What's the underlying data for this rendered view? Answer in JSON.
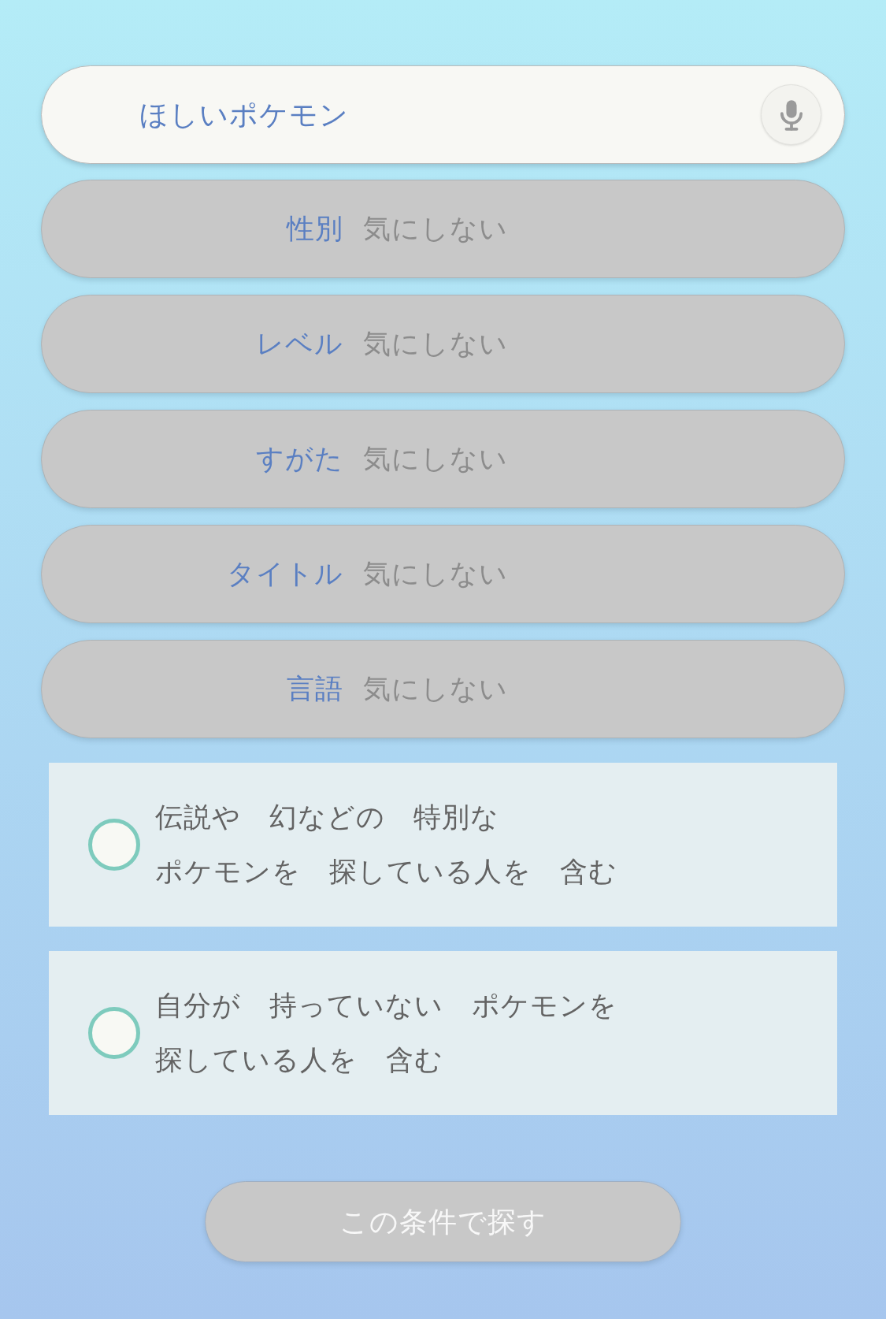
{
  "search": {
    "placeholder": "ほしいポケモン"
  },
  "filters": [
    {
      "label": "性別",
      "value": "気にしない",
      "disabled": true
    },
    {
      "label": "レベル",
      "value": "気にしない",
      "disabled": true
    },
    {
      "label": "すがた",
      "value": "気にしない",
      "disabled": true
    },
    {
      "label": "タイトル",
      "value": "気にしない",
      "disabled": true
    },
    {
      "label": "言語",
      "value": "気にしない",
      "disabled": true
    }
  ],
  "options": [
    {
      "lines": [
        "伝説や　幻などの　特別な",
        "ポケモンを　探している人を　含む"
      ],
      "checked": false
    },
    {
      "lines": [
        "自分が　持っていない　ポケモンを",
        "探している人を　含む"
      ],
      "checked": false
    }
  ],
  "submit": {
    "label": "この条件で探す",
    "disabled": true
  }
}
